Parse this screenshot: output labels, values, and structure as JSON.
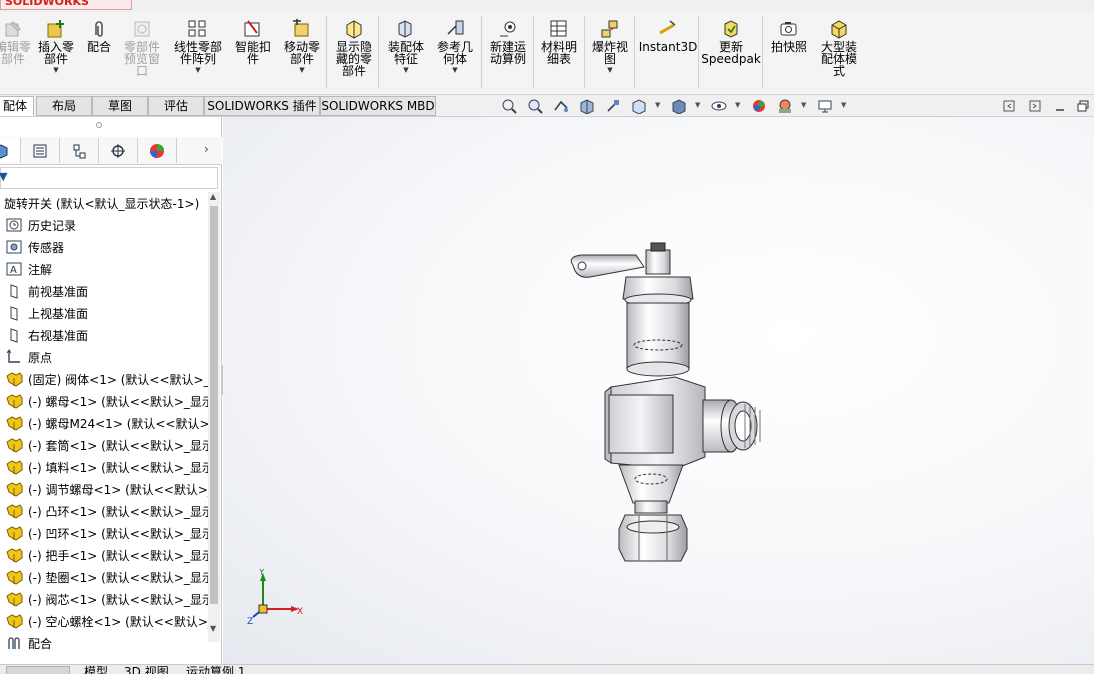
{
  "app": {
    "logo": "SOLIDWORKS"
  },
  "toolbar": {
    "items": [
      {
        "label": "编辑零\n部件",
        "icon": "edit-component-icon",
        "disabled": true
      },
      {
        "label": "插入零\n部件",
        "icon": "insert-component-icon",
        "dropdown": true
      },
      {
        "label": "配合",
        "icon": "mate-paperclip-icon"
      },
      {
        "label": "零部件\n预览窗\n口",
        "icon": "component-preview-icon",
        "disabled": true
      },
      {
        "label": "线性零部\n件阵列",
        "icon": "linear-pattern-icon",
        "dropdown": true
      },
      {
        "label": "智能扣\n件",
        "icon": "smart-fastener-icon"
      },
      {
        "label": "移动零\n部件",
        "icon": "move-component-icon",
        "dropdown": true
      },
      {
        "label": "显示隐\n藏的零\n部件",
        "icon": "show-hidden-icon"
      },
      {
        "label": "装配体\n特征",
        "icon": "assembly-feature-icon",
        "dropdown": true
      },
      {
        "label": "参考几\n何体",
        "icon": "reference-geometry-icon",
        "dropdown": true
      },
      {
        "label": "新建运\n动算例",
        "icon": "new-motion-study-icon"
      },
      {
        "label": "材料明\n细表",
        "icon": "bom-icon"
      },
      {
        "label": "爆炸视\n图",
        "icon": "exploded-view-icon",
        "dropdown": true
      },
      {
        "label": "Instant3D",
        "icon": "instant3d-icon"
      },
      {
        "label": "更新\nSpeedpak",
        "icon": "speedpak-icon"
      },
      {
        "label": "拍快照",
        "icon": "snapshot-icon"
      },
      {
        "label": "大型装\n配体模\n式",
        "icon": "large-assembly-icon"
      }
    ]
  },
  "tabs": [
    {
      "label": "配体",
      "active": true
    },
    {
      "label": "布局"
    },
    {
      "label": "草图"
    },
    {
      "label": "评估"
    },
    {
      "label": "SOLIDWORKS 插件"
    },
    {
      "label": "SOLIDWORKS MBD"
    }
  ],
  "feature_tree": {
    "root": "旋转开关 (默认<默认_显示状态-1>)",
    "items": [
      {
        "label": "历史记录",
        "icon": "history-icon"
      },
      {
        "label": "传感器",
        "icon": "sensor-icon"
      },
      {
        "label": "注解",
        "icon": "annotation-icon"
      },
      {
        "label": "前视基准面",
        "icon": "plane-icon"
      },
      {
        "label": "上视基准面",
        "icon": "plane-icon"
      },
      {
        "label": "右视基准面",
        "icon": "plane-icon"
      },
      {
        "label": "原点",
        "icon": "origin-icon"
      },
      {
        "label": "(固定) 阀体<1> (默认<<默认>_显",
        "icon": "part-icon"
      },
      {
        "label": "(-) 螺母<1> (默认<<默认>_显示",
        "icon": "part-icon"
      },
      {
        "label": "(-) 螺母M24<1> (默认<<默认>_",
        "icon": "part-icon"
      },
      {
        "label": "(-) 套筒<1> (默认<<默认>_显示",
        "icon": "part-icon"
      },
      {
        "label": "(-) 填料<1> (默认<<默认>_显示",
        "icon": "part-icon"
      },
      {
        "label": "(-) 调节螺母<1> (默认<<默认>_",
        "icon": "part-icon"
      },
      {
        "label": "(-) 凸环<1> (默认<<默认>_显示",
        "icon": "part-icon"
      },
      {
        "label": "(-) 凹环<1> (默认<<默认>_显示",
        "icon": "part-icon"
      },
      {
        "label": "(-) 把手<1> (默认<<默认>_显示",
        "icon": "part-icon"
      },
      {
        "label": "(-) 垫圈<1> (默认<<默认>_显示",
        "icon": "part-icon"
      },
      {
        "label": "(-) 阀芯<1> (默认<<默认>_显示",
        "icon": "part-icon"
      },
      {
        "label": "(-) 空心螺栓<1> (默认<<默认>_",
        "icon": "part-icon"
      },
      {
        "label": "配合",
        "icon": "mates-icon"
      }
    ]
  },
  "triad": {
    "x_label": "X",
    "y_label": "Y",
    "z_label": "Z"
  },
  "bottom_tabs": [
    {
      "label": "模型"
    },
    {
      "label": "3D 视图"
    },
    {
      "label": "运动算例 1"
    }
  ],
  "colors": {
    "part_icon": "#e8b400",
    "logo_red": "#d2221c",
    "axis_x": "#d32020",
    "axis_y": "#1c8a1c",
    "axis_z": "#2040c0"
  }
}
